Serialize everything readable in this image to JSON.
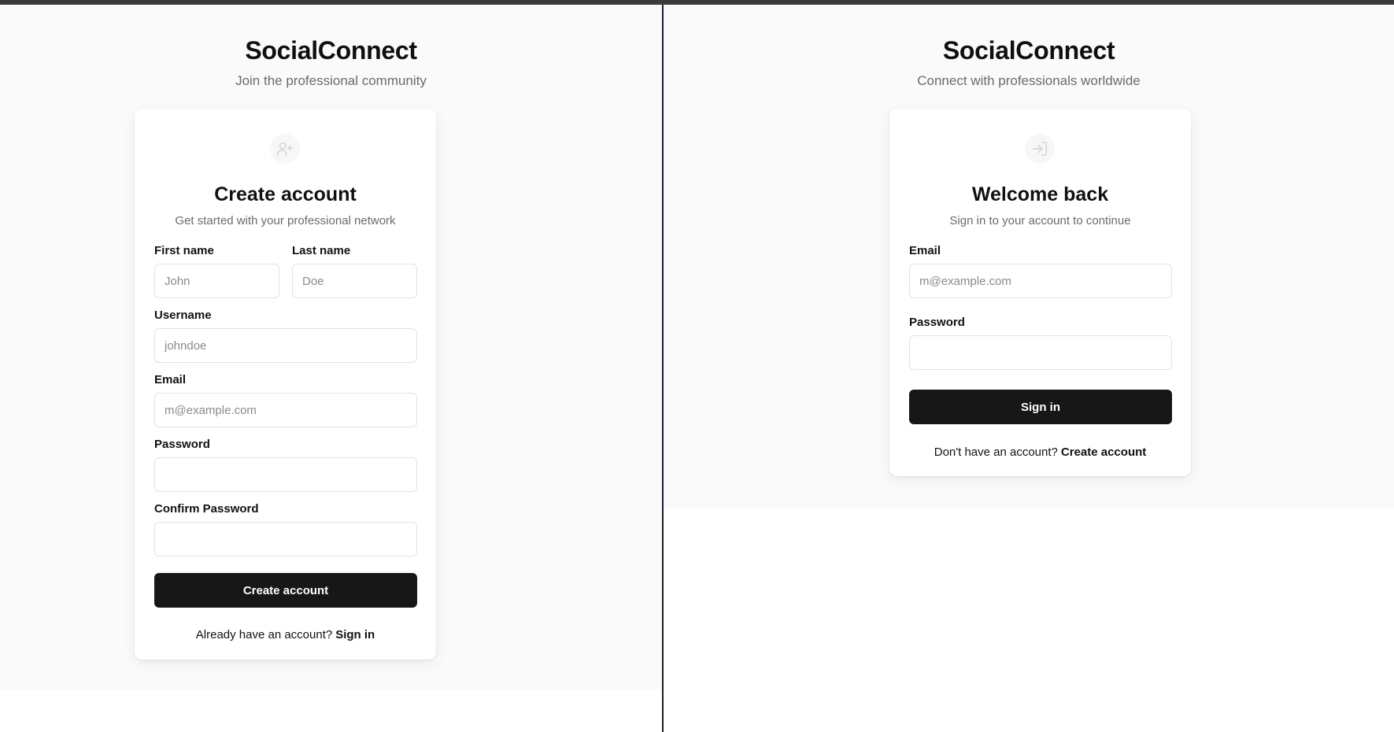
{
  "signup": {
    "brand": "SocialConnect",
    "tagline": "Join the professional community",
    "icon": "user-plus-icon",
    "title": "Create account",
    "subtitle": "Get started with your professional network",
    "first_name_label": "First name",
    "first_name_placeholder": "John",
    "last_name_label": "Last name",
    "last_name_placeholder": "Doe",
    "username_label": "Username",
    "username_placeholder": "johndoe",
    "email_label": "Email",
    "email_placeholder": "m@example.com",
    "password_label": "Password",
    "confirm_password_label": "Confirm Password",
    "submit_label": "Create account",
    "footer_text": "Already have an account?",
    "footer_link": "Sign in"
  },
  "signin": {
    "brand": "SocialConnect",
    "tagline": "Connect with professionals worldwide",
    "icon": "log-in-icon",
    "title": "Welcome back",
    "subtitle": "Sign in to your account to continue",
    "email_label": "Email",
    "email_placeholder": "m@example.com",
    "password_label": "Password",
    "submit_label": "Sign in",
    "footer_text": "Don't have an account?",
    "footer_link": "Create account"
  },
  "colors": {
    "page_background": "#fafafa",
    "card_background": "#ffffff",
    "primary_button": "#171717",
    "muted_text": "#6b6b6b",
    "input_border": "#e3e3e3"
  }
}
